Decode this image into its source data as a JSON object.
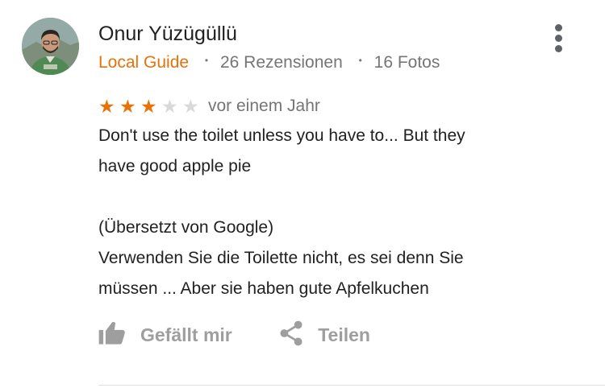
{
  "review": {
    "author_name": "Onur Yüzügüllü",
    "badge": "Local Guide",
    "separator": "•",
    "reviews_count": "26 Rezensionen",
    "photos_count": "16 Fotos",
    "rating": 3,
    "rating_max": 5,
    "date": "vor einem Jahr",
    "text_original_line1": "Don't use the toilet unless you have to... But they",
    "text_original_line2": "have good apple pie",
    "translation_label": "(Übersetzt von Google)",
    "text_translated_line1": "Verwenden Sie die Toilette nicht, es sei denn Sie",
    "text_translated_line2": "müssen ... Aber sie haben gute Apfelkuchen"
  },
  "actions": {
    "like_label": "Gefällt mir",
    "share_label": "Teilen"
  },
  "colors": {
    "accent": "#e8710a",
    "star_empty": "#d9d9d9",
    "secondary_text": "#757575",
    "action_text": "#9e9e9e",
    "icon_gray": "#5f6368"
  },
  "icons": {
    "more": "more-vert-icon",
    "like": "thumb-up-icon",
    "share": "share-icon",
    "star": "star-icon"
  }
}
